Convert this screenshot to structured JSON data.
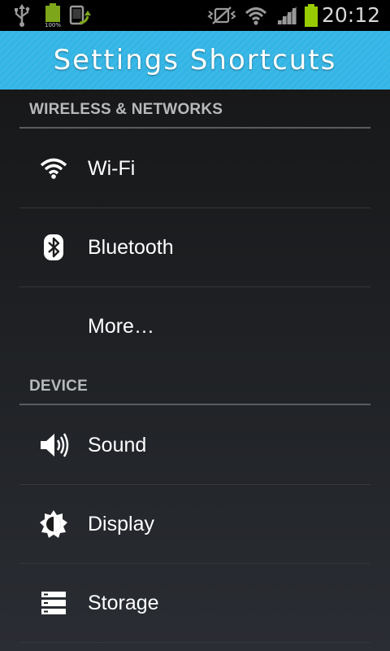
{
  "status_bar": {
    "time": "20:12",
    "battery_mini_label": "100%",
    "icons": [
      "usb-icon",
      "battery-full-mini-icon",
      "screen-rotate-icon",
      "vibrate-mute-icon",
      "wifi-signal-icon",
      "cell-signal-icon",
      "battery-charging-icon"
    ]
  },
  "header": {
    "title": "Settings Shortcuts",
    "accent_color": "#33b5e5"
  },
  "sections": [
    {
      "title": "WIRELESS & NETWORKS",
      "items": [
        {
          "label": "Wi-Fi",
          "icon": "wifi-icon"
        },
        {
          "label": "Bluetooth",
          "icon": "bluetooth-icon"
        },
        {
          "label": "More…",
          "icon": ""
        }
      ]
    },
    {
      "title": "DEVICE",
      "items": [
        {
          "label": "Sound",
          "icon": "sound-icon"
        },
        {
          "label": "Display",
          "icon": "display-brightness-icon"
        },
        {
          "label": "Storage",
          "icon": "storage-icon"
        }
      ]
    }
  ]
}
